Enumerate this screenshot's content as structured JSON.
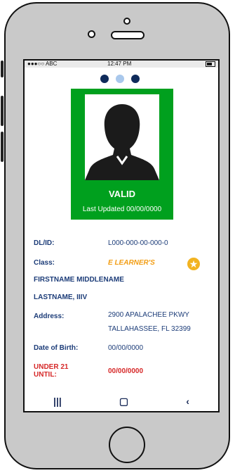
{
  "status_bar": {
    "carrier": "●●●○○ ABC",
    "time": "12:47 PM"
  },
  "carousel": {
    "dot_colors": [
      "#0e2a5a",
      "#a9c8ec",
      "#0e2a5a"
    ]
  },
  "card": {
    "status": "VALID",
    "last_updated": "Last Updated 00/00/0000",
    "accent_color": "#00a01e"
  },
  "fields": {
    "dl_label": "DL/ID:",
    "dl_value": "L000-000-00-000-0",
    "class_label": "Class:",
    "class_value": "E LEARNER'S",
    "name_line1": "FIRSTNAME MIDDLENAME",
    "name_line2": "LASTNAME, IIIV",
    "address_label": "Address:",
    "address_line1": "2900 APALACHEE PKWY",
    "address_line2": "TALLAHASSEE, FL 32399",
    "dob_label": "Date of Birth:",
    "dob_value": "00/00/0000",
    "under21_label_1": "UNDER 21",
    "under21_label_2": "UNTIL:",
    "under21_value": "00/00/0000"
  },
  "nav": {
    "items": [
      "recent-apps-icon",
      "home-icon",
      "back-icon"
    ]
  }
}
